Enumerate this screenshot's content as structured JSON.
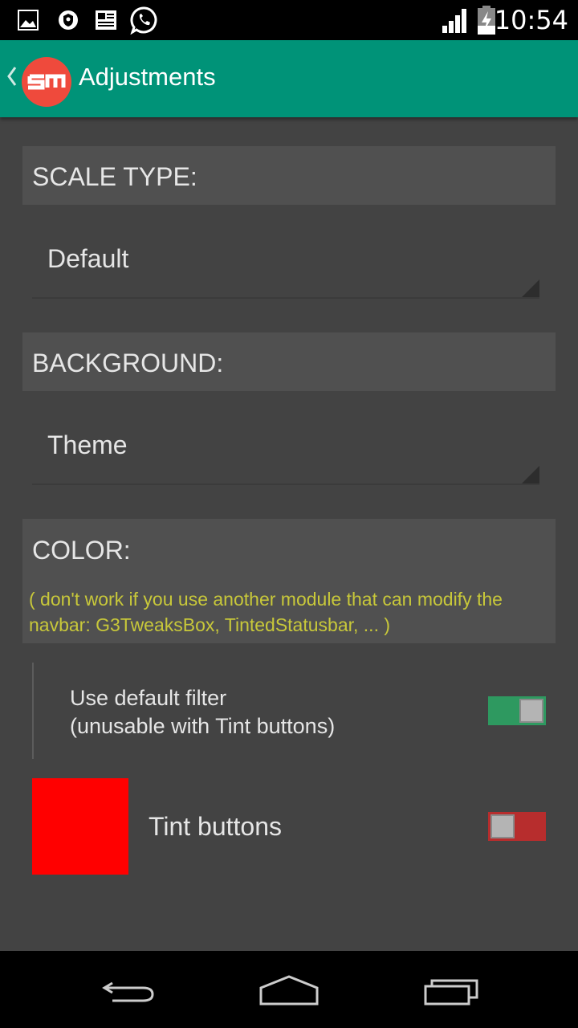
{
  "status_bar": {
    "time": "10:54",
    "icons": [
      "image-icon",
      "shield-icon",
      "card-icon",
      "whatsapp-icon",
      "signal-icon",
      "battery-charging-icon"
    ]
  },
  "action_bar": {
    "title": "Adjustments",
    "logo_color": "#ef4a3c",
    "background": "#009378"
  },
  "sections": {
    "scale_type": {
      "title": "SCALE TYPE:",
      "value": "Default"
    },
    "background": {
      "title": "BACKGROUND:",
      "value": "Theme"
    },
    "color": {
      "title": "COLOR:",
      "note": "( don't work if you use another module that can modify the navbar: G3TweaksBox, TintedStatusbar, ... )"
    }
  },
  "preferences": {
    "default_filter": {
      "line1": "Use default filter",
      "line2": "(unusable with Tint buttons)",
      "enabled": true
    },
    "tint_buttons": {
      "label": "Tint buttons",
      "enabled": false,
      "swatch_color": "#ff0000"
    }
  },
  "colors": {
    "switch_on": "#2e9960",
    "switch_off": "#b72d2d",
    "note_text": "#c8c83a"
  },
  "nav_bar": {
    "buttons": [
      "back-icon",
      "home-icon",
      "recents-icon"
    ]
  }
}
